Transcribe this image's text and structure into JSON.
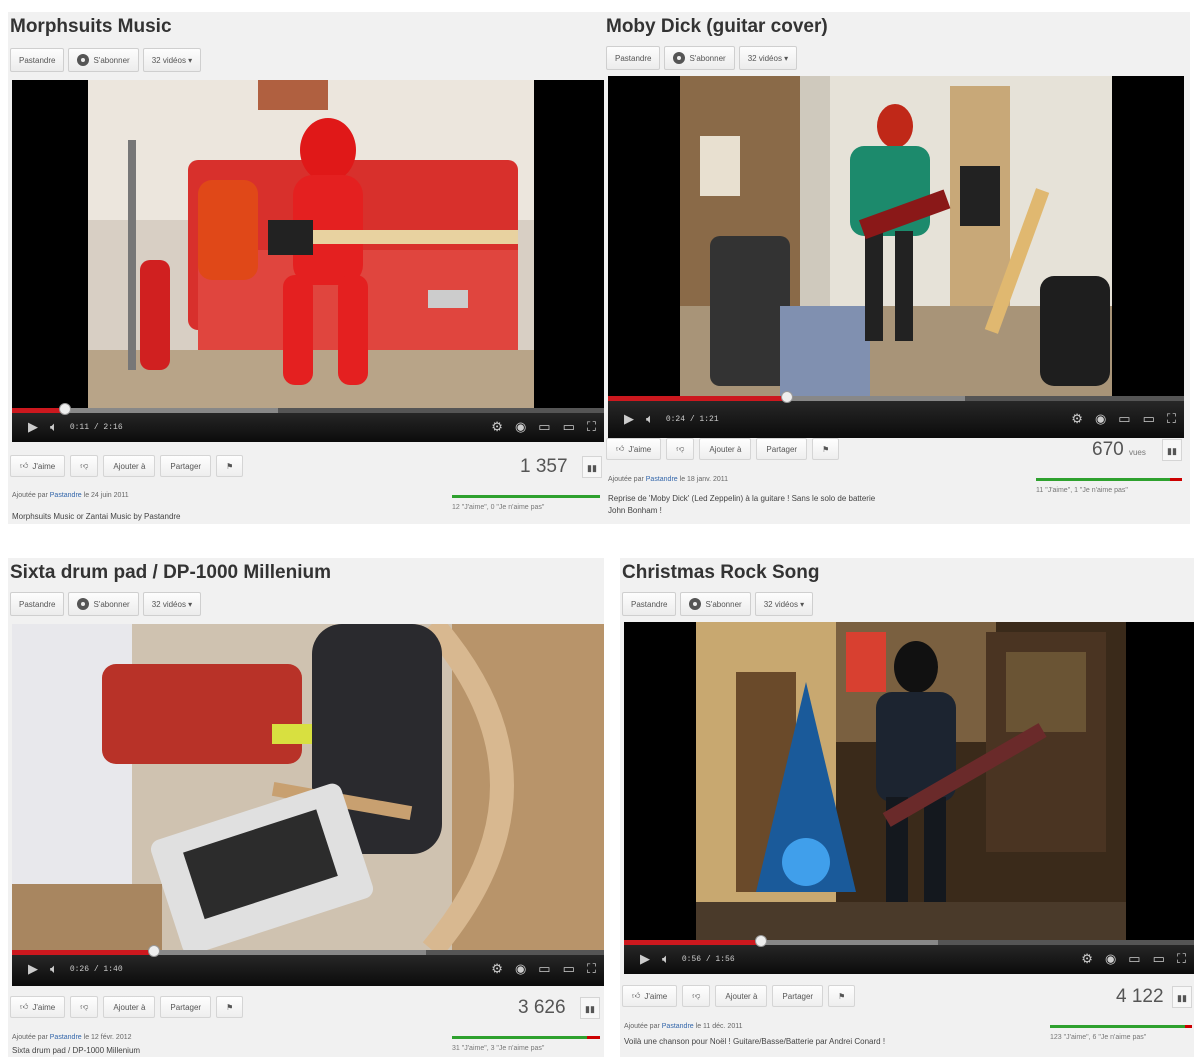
{
  "videos": [
    {
      "title": "Morphsuits Music",
      "channel_btn": "Pastandre",
      "subscribe_btn": "S'abonner",
      "videos_btn": "32 vidéos ▾",
      "time": "0:11 / 2:16",
      "progress": 0.09,
      "buffered": 0.45,
      "like_btn": "J'aime",
      "addto_btn": "Ajouter à",
      "share_btn": "Partager",
      "views": "1 357",
      "likes_text": "12 \"J'aime\", 0 \"Je n'aime pas\"",
      "like_ratio": 1.0,
      "meta_prefix": "Ajoutée par",
      "meta_user": "Pastandre",
      "meta_date": "le 24 juin 2011",
      "desc_line1": "Morphsuits Music or Zantai Music by Pastandre",
      "desc_line2": ""
    },
    {
      "title": "Moby Dick (guitar cover)",
      "channel_btn": "Pastandre",
      "subscribe_btn": "S'abonner",
      "videos_btn": "32 vidéos ▾",
      "time": "0:24 / 1:21",
      "progress": 0.31,
      "buffered": 0.62,
      "like_btn": "J'aime",
      "addto_btn": "Ajouter à",
      "share_btn": "Partager",
      "views": "670",
      "views_suffix": "vues",
      "likes_text": "11 \"J'aime\", 1 \"Je n'aime pas\"",
      "like_ratio": 0.92,
      "meta_prefix": "Ajoutée par",
      "meta_user": "Pastandre",
      "meta_date": "le 18 janv. 2011",
      "desc_line1": "Reprise de 'Moby Dick' (Led Zeppelin) à la guitare ! Sans le solo de batterie",
      "desc_line2": "John Bonham !"
    },
    {
      "title": "Sixta drum pad / DP-1000 Millenium",
      "channel_btn": "Pastandre",
      "subscribe_btn": "S'abonner",
      "videos_btn": "32 vidéos ▾",
      "time": "0:26 / 1:40",
      "progress": 0.24,
      "buffered": 0.7,
      "like_btn": "J'aime",
      "addto_btn": "Ajouter à",
      "share_btn": "Partager",
      "views": "3 626",
      "likes_text": "31 \"J'aime\", 3 \"Je n'aime pas\"",
      "like_ratio": 0.91,
      "meta_prefix": "Ajoutée par",
      "meta_user": "Pastandre",
      "meta_date": "le 12 févr. 2012",
      "desc_line1": "Sixta drum pad / DP-1000 Millenium",
      "desc_line2": ""
    },
    {
      "title": "Christmas Rock Song",
      "channel_btn": "Pastandre",
      "subscribe_btn": "S'abonner",
      "videos_btn": "32 vidéos ▾",
      "time": "0:56 / 1:56",
      "progress": 0.24,
      "buffered": 0.55,
      "like_btn": "J'aime",
      "addto_btn": "Ajouter à",
      "share_btn": "Partager",
      "views": "4 122",
      "likes_text": "123 \"J'aime\", 6 \"Je n'aime pas\"",
      "like_ratio": 0.95,
      "meta_prefix": "Ajoutée par",
      "meta_user": "Pastandre",
      "meta_date": "le 11 déc. 2011",
      "desc_line1": "Voilà une chanson pour Noël ! Guitare/Basse/Batterie par Andrei Conard !",
      "desc_line2": ""
    }
  ]
}
